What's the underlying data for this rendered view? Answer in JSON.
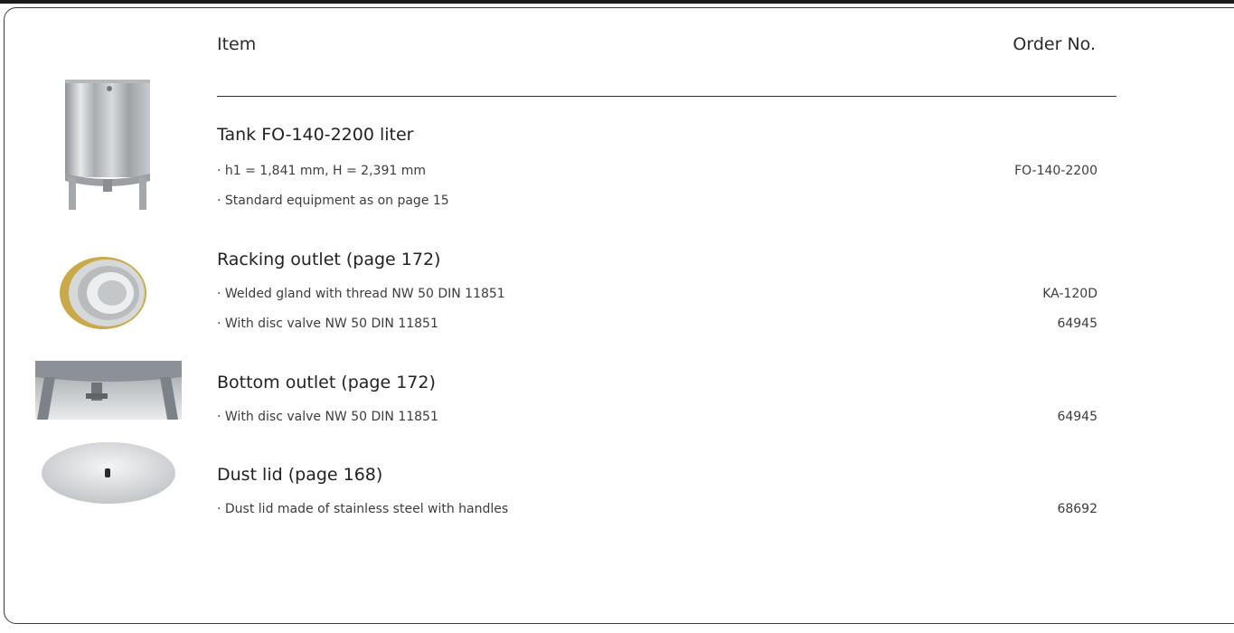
{
  "header": {
    "item_label": "Item",
    "order_label": "Order No."
  },
  "rows": [
    {
      "title": "Tank FO-140-2200 liter",
      "lines": [
        {
          "text": "· h1 = 1,841 mm, H = 2,391 mm",
          "order": "FO-140-2200"
        },
        {
          "text": "· Standard equipment as on page 15",
          "order": ""
        }
      ]
    },
    {
      "title": "Racking outlet (page 172)",
      "lines": [
        {
          "text": "· Welded gland with thread NW 50 DIN 11851",
          "order": "KA-120D"
        },
        {
          "text": "· With disc valve NW 50 DIN 11851",
          "order": "64945"
        }
      ]
    },
    {
      "title": "Bottom outlet (page 172)",
      "lines": [
        {
          "text": "· With disc valve NW 50 DIN 11851",
          "order": "64945"
        }
      ]
    },
    {
      "title": "Dust lid (page 168)",
      "lines": [
        {
          "text": "· Dust lid made of stainless steel with handles",
          "order": "68692"
        }
      ]
    }
  ]
}
